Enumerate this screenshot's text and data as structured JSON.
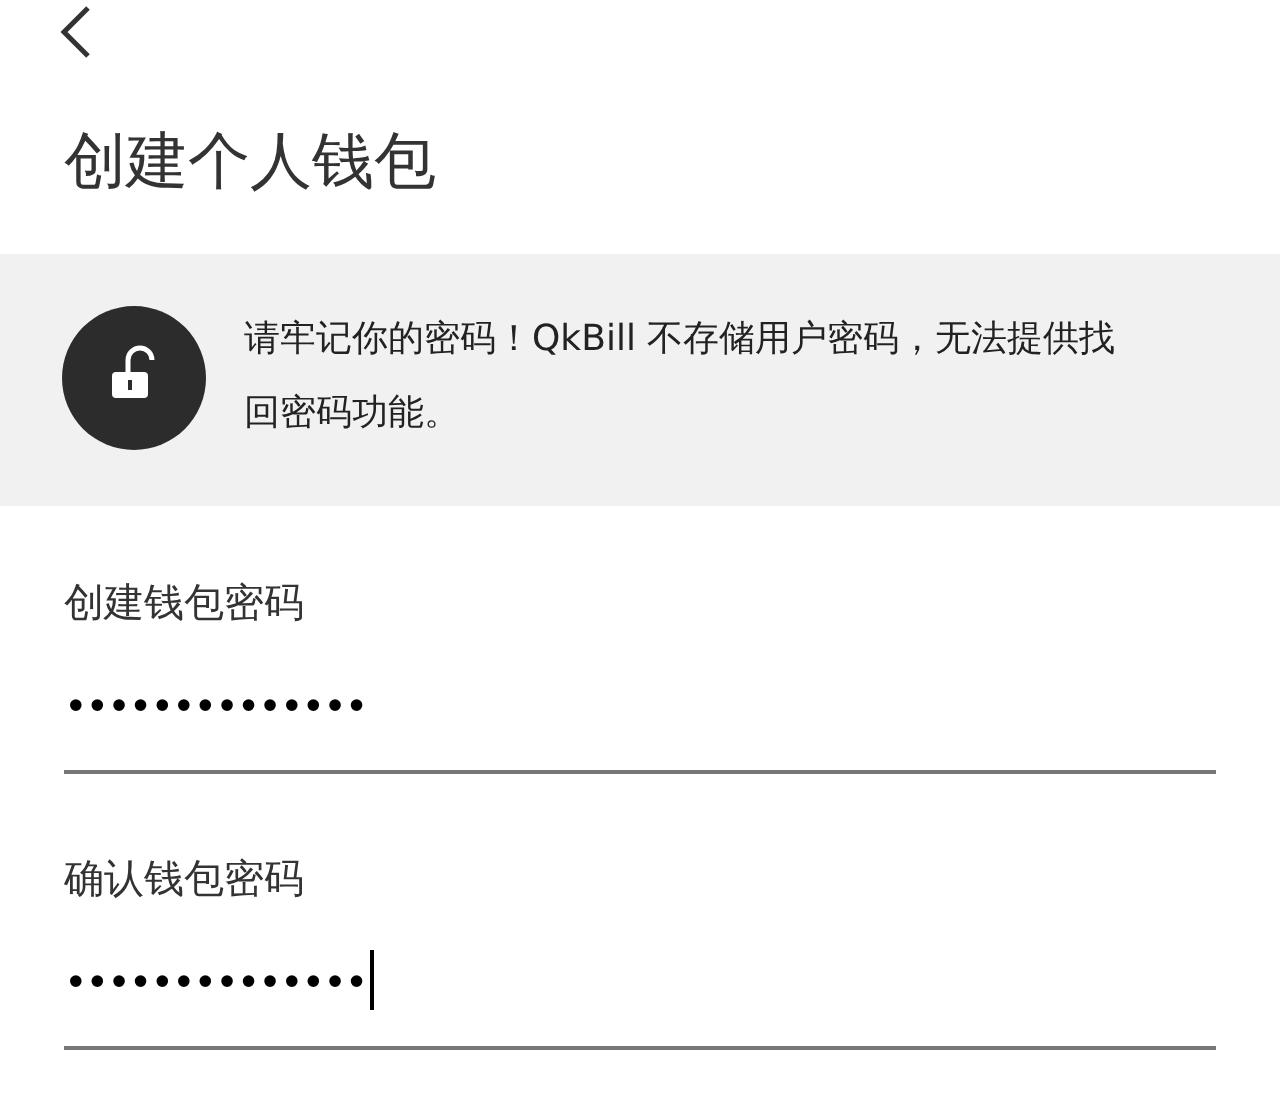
{
  "title": "创建个人钱包",
  "notice": {
    "text": "请牢记你的密码！QkBill 不存储用户密码，无法提供找回密码功能。"
  },
  "fields": [
    {
      "label": "创建钱包密码",
      "value": "••••••••••••••",
      "focused": false
    },
    {
      "label": "确认钱包密码",
      "value": "••••••••••••••",
      "focused": true
    }
  ]
}
